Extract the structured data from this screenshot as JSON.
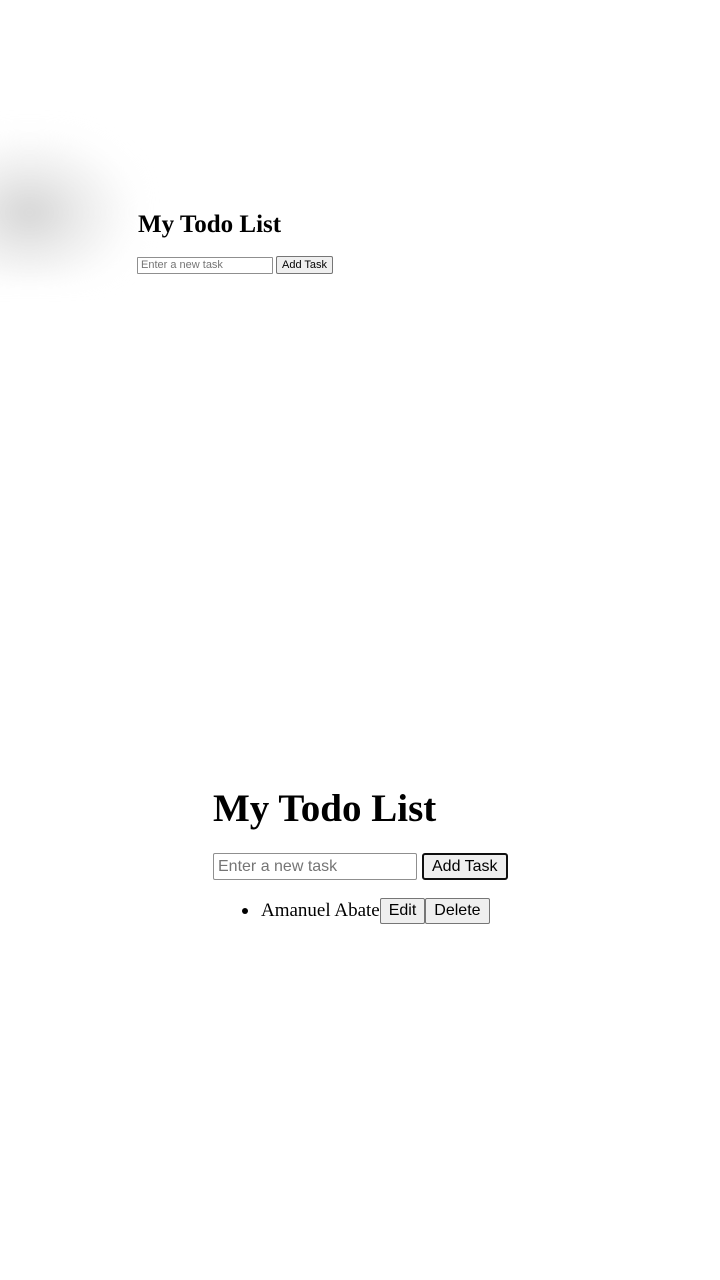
{
  "top_panel": {
    "title": "My Todo List",
    "input_placeholder": "Enter a new task",
    "add_button_label": "Add Task"
  },
  "bottom_panel": {
    "title": "My Todo List",
    "input_placeholder": "Enter a new task",
    "add_button_label": "Add Task",
    "tasks": [
      {
        "text": "Amanuel Abate",
        "edit_label": "Edit",
        "delete_label": "Delete"
      }
    ]
  }
}
